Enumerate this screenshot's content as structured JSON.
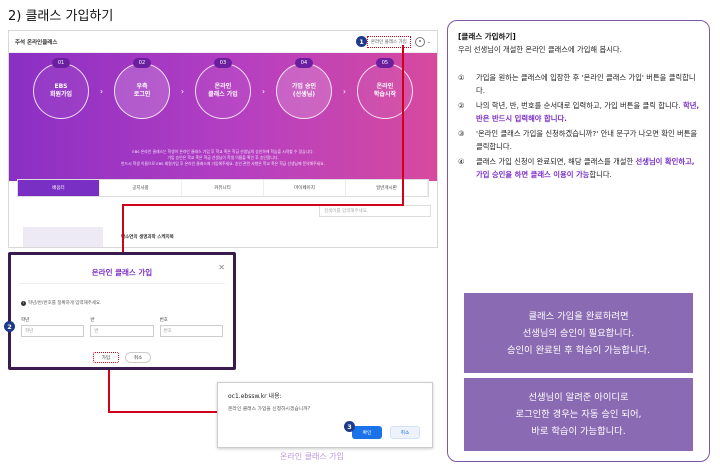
{
  "heading": "2) 클래스 가입하기",
  "site": {
    "name": "주석 온라인클래스",
    "join_link": "온라인 클래스 가입",
    "banner_steps": [
      {
        "num": "01",
        "label": "EBS\n회원가입"
      },
      {
        "num": "02",
        "label": "우측\n로그인"
      },
      {
        "num": "03",
        "label": "온라인\n클래스 가입"
      },
      {
        "num": "04",
        "label": "가입 승인\n(선생님)"
      },
      {
        "num": "05",
        "label": "온라인\n학습시작"
      }
    ],
    "banner_notes": [
      "EBS 온라인 클래스는 학생이 온라인 클래스 가입 후 학교 혹은 학급 선생님의 승인하에 학습을 시작할 수 있습니다.",
      "가입 승인은 학교 혹은 학급 선생님이 학생 이름을 확인 후 승인합니다.",
      "반드시 학생 이름으로 EBS 회원가입 후 온라인 클래스에 가입해주세요. 승인 관련 사항은 학교 혹은 학급 선생님께 문의해주세요."
    ],
    "tabs": [
      "배움터",
      "공지사항",
      "커뮤니티",
      "마이페이지",
      "일반게시판"
    ],
    "search_placeholder": "검색어를 입력해주세요.",
    "class_title": "박소연의 생명과학 스케치북"
  },
  "modal": {
    "title": "온라인 클래스 가입",
    "info": "학년/반/번호를 정확하게 입력해주세요.",
    "fields": [
      {
        "label": "학년",
        "placeholder": "학년"
      },
      {
        "label": "반",
        "placeholder": "반"
      },
      {
        "label": "번호",
        "placeholder": "번호"
      }
    ],
    "join_button": "가입",
    "cancel_button": "취소"
  },
  "confirm": {
    "title": "oc1.ebssw.kr 내용:",
    "message": "온라인 클래스 가입을 신청하시겠습니까?",
    "ok_button": "확인",
    "cancel_button": "취소"
  },
  "callouts": [
    "1",
    "2",
    "3"
  ],
  "under_text": "온라인 클래스 가입",
  "panel": {
    "title": "[클래스 가입하기]",
    "intro": "우리 선생님이 개설한 온라인 클래스에 가입해 봅시다.",
    "steps": [
      {
        "num": "①",
        "parts": [
          {
            "t": "가입을 원하는 클래스에 입장한 후 '온라인 클래스 가입' 버튼을 클릭합니다."
          }
        ]
      },
      {
        "num": "②",
        "parts": [
          {
            "t": "나의 학년, 반, 번호를 순서대로 입력하고, 가입 버튼을 클릭 합니다. "
          },
          {
            "t": "학년, 반은 반드시 입력해야 합니다.",
            "em": true
          }
        ]
      },
      {
        "num": "③",
        "parts": [
          {
            "t": "'온라인 클래스 가입을 신청하겠습니까?' 안내 문구가 나오면 확인 버튼을 클릭합니다."
          }
        ]
      },
      {
        "num": "④",
        "parts": [
          {
            "t": "클래스 가입 신청이 완료되면, 해당 클래스를 개설한 "
          },
          {
            "t": "선생님이 확인하고, 가입 승인을 하면 클래스 이용이 가능",
            "em": true
          },
          {
            "t": "합니다."
          }
        ]
      }
    ],
    "note1": [
      "클래스 가입을 완료하려면",
      "선생님의 승인이 필요합니다.",
      "승인이 완료된 후 학습이 가능합니다."
    ],
    "note2": [
      "선생님이 알려준 아이디로",
      "로그인한 경우는 자동 승인 되어,",
      "바로 학습이 가능합니다."
    ]
  },
  "colors": {
    "accent": "#7a2fc4",
    "callout": "#1e3a8a",
    "highlight": "#d0021b",
    "note_bg": "#8a6ab2"
  }
}
